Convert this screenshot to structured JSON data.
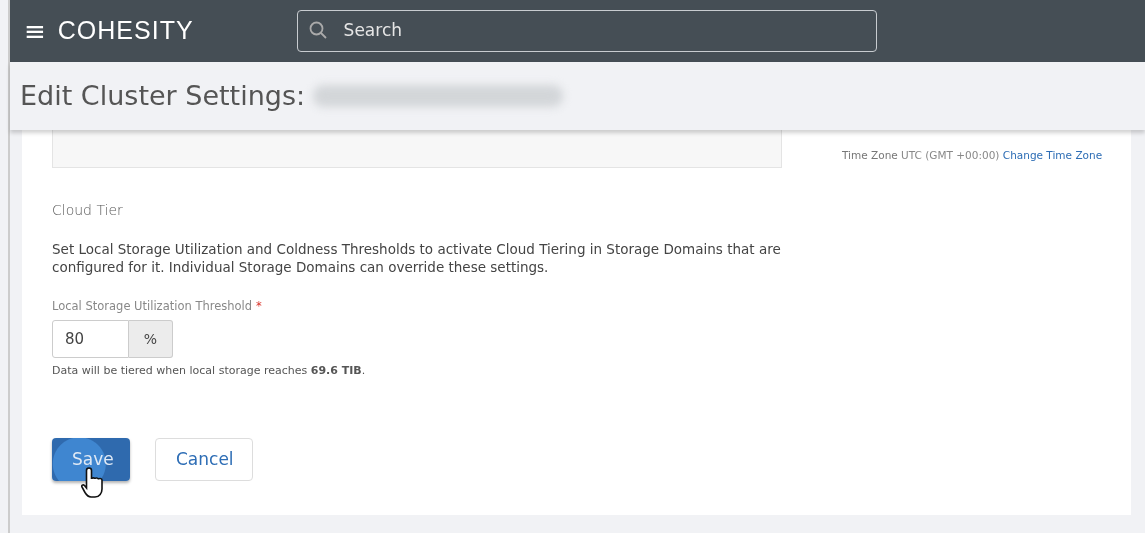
{
  "navbar": {
    "menu_icon": "≡",
    "logo": "COHESITY",
    "search": {
      "placeholder": "Search"
    }
  },
  "page_header": {
    "title": "Edit Cluster Settings:"
  },
  "time_zone": {
    "label": "Time Zone",
    "value": "UTC (GMT +00:00)",
    "link": "Change Time Zone"
  },
  "cloud_tier": {
    "heading": "Cloud Tier",
    "description": "Set Local Storage Utilization and Coldness Thresholds to activate Cloud Tiering in Storage Domains that are configured for it. Individual Storage Domains can override these settings.",
    "field": {
      "label": "Local Storage Utilization Threshold",
      "required_mark": "*",
      "value": "80",
      "unit": "%"
    },
    "help": "Data will be tiered when local storage reaches **69.6 TIB**."
  },
  "buttons": [
    {
      "label": "Save",
      "kind": "primary",
      "hovered": true
    },
    {
      "label": "Cancel",
      "kind": "secondary",
      "hovered": false
    }
  ]
}
